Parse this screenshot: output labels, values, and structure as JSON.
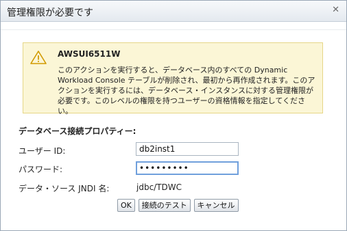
{
  "dialog": {
    "title": "管理権限が必要です",
    "close_symbol": "✕"
  },
  "warning": {
    "code": "AWSUI6511W",
    "message": "このアクションを実行すると、データベース内のすべての Dynamic Workload Console テーブルが削除され、最初から再作成されます。このアクションを実行するには、データベース・インスタンスに対する管理権限が必要です。このレベルの権限を持つユーザーの資格情報を指定してください。",
    "icon": "warning-triangle-icon",
    "bg_color": "#fbf6d6",
    "border_color": "#e6d687"
  },
  "form": {
    "section_title": "データベース接続プロパティー:",
    "user_label": "ユーザー ID:",
    "user_value": "db2inst1",
    "password_label": "パスワード:",
    "password_value": "•••••••••",
    "jndi_label": "データ・ソース JNDI 名:",
    "jndi_value": "jdbc/TDWC"
  },
  "buttons": {
    "ok": "OK",
    "test": "接続のテスト",
    "cancel": "キャンセル"
  }
}
